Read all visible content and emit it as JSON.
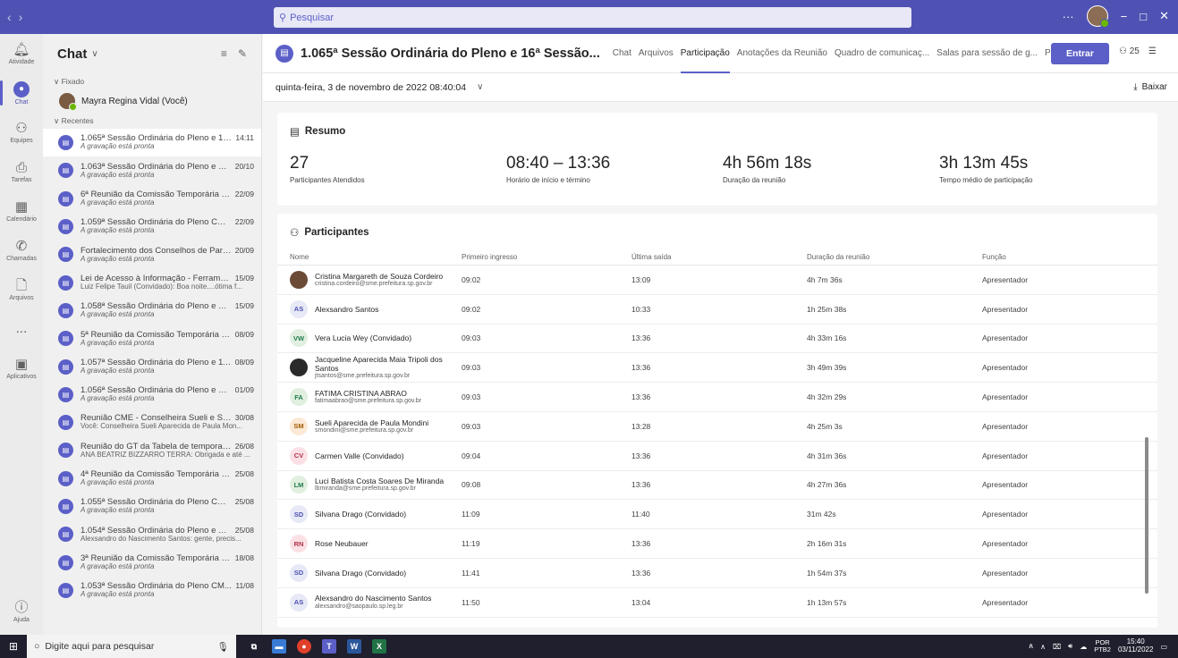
{
  "titlebar": {
    "search_placeholder": "Pesquisar",
    "more": "···",
    "minimize": "−",
    "maximize": "□",
    "close": "✕"
  },
  "appbar": {
    "items": [
      {
        "label": "Atividade",
        "icon": "bell-icon"
      },
      {
        "label": "Chat",
        "icon": "chat-icon"
      },
      {
        "label": "Equipes",
        "icon": "teams-icon"
      },
      {
        "label": "Tarefas",
        "icon": "tasks-icon"
      },
      {
        "label": "Calendário",
        "icon": "calendar-icon"
      },
      {
        "label": "Chamadas",
        "icon": "phone-icon"
      },
      {
        "label": "Arquivos",
        "icon": "files-icon"
      },
      {
        "label": "...",
        "icon": "more-icon"
      },
      {
        "label": "Aplicativos",
        "icon": "apps-icon"
      }
    ],
    "help_label": "Ajuda"
  },
  "chatlist": {
    "title": "Chat",
    "pinned_label": "Fixado",
    "recent_label": "Recentes",
    "pinned": {
      "name": "Mayra Regina Vidal (Você)"
    },
    "items": [
      {
        "title": "1.065ª Sessão Ordinária do Pleno e 16...",
        "date": "14:11",
        "preview": "A gravação está pronta",
        "italic": true
      },
      {
        "title": "1.063ª Sessão Ordinária do Pleno e 14...",
        "date": "20/10",
        "preview": "A gravação está pronta",
        "italic": true
      },
      {
        "title": "6ª Reunião da Comissão Temporária d...",
        "date": "22/09",
        "preview": "A gravação está pronta",
        "italic": true
      },
      {
        "title": "1.059ª Sessão Ordinária do Pleno CM...",
        "date": "22/09",
        "preview": "A gravação está pronta",
        "italic": true
      },
      {
        "title": "Fortalecimento dos Conselhos de Part...",
        "date": "20/09",
        "preview": "A gravação está pronta",
        "italic": true
      },
      {
        "title": "Lei de Acesso à Informação - Ferrame...",
        "date": "15/09",
        "preview": "Luiz Felipe Tauil (Convidado): Boa noite....ótima f...",
        "italic": false
      },
      {
        "title": "1.058ª Sessão Ordinária do Pleno e 12...",
        "date": "15/09",
        "preview": "A gravação está pronta",
        "italic": true
      },
      {
        "title": "5ª Reunião da Comissão Temporária d...",
        "date": "08/09",
        "preview": "A gravação está pronta",
        "italic": true
      },
      {
        "title": "1.057ª Sessão Ordinária do Pleno e 11...",
        "date": "08/09",
        "preview": "A gravação está pronta",
        "italic": true
      },
      {
        "title": "1.056ª Sessão Ordinária do Pleno e 10...",
        "date": "01/09",
        "preview": "A gravação está pronta",
        "italic": true
      },
      {
        "title": "Reunião CME - Conselheira Sueli e Se...",
        "date": "30/08",
        "preview": "Você: Conselheira Sueli Aparecida de Paula Mon...",
        "italic": false
      },
      {
        "title": "Reunião do GT da Tabela de temporali...",
        "date": "26/08",
        "preview": "ANA BEATRIZ BIZZARRO TERRA: Obrigada e até ...",
        "italic": false
      },
      {
        "title": "4ª Reunião da Comissão Temporária d...",
        "date": "25/08",
        "preview": "A gravação está pronta",
        "italic": true
      },
      {
        "title": "1.055ª Sessão Ordinária do Pleno CM...",
        "date": "25/08",
        "preview": "A gravação está pronta",
        "italic": true
      },
      {
        "title": "1.054ª Sessão Ordinária do Pleno e 9ª...",
        "date": "25/08",
        "preview": "Alexsandro do Nascimento Santos: gente, precis...",
        "italic": false
      },
      {
        "title": "3ª Reunião da Comissão Temporária d...",
        "date": "18/08",
        "preview": "A gravação está pronta",
        "italic": true
      },
      {
        "title": "1.053ª Sessão Ordinária do Pleno CM...",
        "date": "11/08",
        "preview": "A gravação está pronta",
        "italic": true
      }
    ]
  },
  "header": {
    "title": "1.065ª Sessão Ordinária do Pleno e 16ª Sessão...",
    "tabs": [
      "Chat",
      "Arquivos",
      "Participação",
      "Anotações da Reunião",
      "Quadro de comunicaç...",
      "Salas para sessão de g...",
      "P&R"
    ],
    "active_tab": "Participação",
    "join_label": "Entrar",
    "participants_count": "25"
  },
  "subheader": {
    "date": "quinta-feira, 3 de novembro de 2022 08:40:04",
    "download_label": "Baixar"
  },
  "summary": {
    "title": "Resumo",
    "stats": [
      {
        "value": "27",
        "label": "Participantes Atendidos"
      },
      {
        "value": "08:40 – 13:36",
        "label": "Horário de início e término"
      },
      {
        "value": "4h 56m 18s",
        "label": "Duração da reunião"
      },
      {
        "value": "3h 13m 45s",
        "label": "Tempo médio de participação"
      }
    ]
  },
  "participants": {
    "title": "Participantes",
    "columns": [
      "Nome",
      "Primeiro ingresso",
      "Última saída",
      "Duração da reunião",
      "Função"
    ],
    "rows": [
      {
        "name": "Cristina Margareth de Souza Cordeiro",
        "email": "cristina.cordeiro@sme.prefeitura.sp.gov.br",
        "initials": "",
        "color": "photo",
        "first": "09:02",
        "last": "13:09",
        "duration": "4h 7m 36s",
        "role": "Apresentador"
      },
      {
        "name": "Alexsandro Santos",
        "email": "",
        "initials": "AS",
        "color": "#e7e9f6",
        "fg": "#4f52b2",
        "first": "09:02",
        "last": "10:33",
        "duration": "1h 25m 38s",
        "role": "Apresentador"
      },
      {
        "name": "Vera Lucia Wey (Convidado)",
        "email": "",
        "initials": "VW",
        "color": "#e0efe0",
        "fg": "#237b4b",
        "first": "09:03",
        "last": "13:36",
        "duration": "4h 33m 16s",
        "role": "Apresentador"
      },
      {
        "name": "Jacqueline Aparecida Maia Tripoli dos Santos",
        "email": "jtsantos@sme.prefeitura.sp.gov.br",
        "initials": "",
        "color": "photo2",
        "first": "09:03",
        "last": "13:36",
        "duration": "3h 49m 39s",
        "role": "Apresentador"
      },
      {
        "name": "FATIMA CRISTINA ABRAO",
        "email": "fatimaabrao@sme.prefeitura.sp.gov.br",
        "initials": "FA",
        "color": "#e0efe0",
        "fg": "#237b4b",
        "first": "09:03",
        "last": "13:36",
        "duration": "4h 32m 29s",
        "role": "Apresentador"
      },
      {
        "name": "Sueli Aparecida de Paula Mondini",
        "email": "smondini@sme.prefeitura.sp.gov.br",
        "initials": "SM",
        "color": "#fbe9d5",
        "fg": "#a05a00",
        "first": "09:03",
        "last": "13:28",
        "duration": "4h 25m 3s",
        "role": "Apresentador"
      },
      {
        "name": "Carmen Valle (Convidado)",
        "email": "",
        "initials": "CV",
        "color": "#fbe1e6",
        "fg": "#b0304a",
        "first": "09:04",
        "last": "13:36",
        "duration": "4h 31m 36s",
        "role": "Apresentador"
      },
      {
        "name": "Luci Batista Costa Soares De Miranda",
        "email": "lbmiranda@sme.prefeitura.sp.gov.br",
        "initials": "LM",
        "color": "#e0efe0",
        "fg": "#237b4b",
        "first": "09:08",
        "last": "13:36",
        "duration": "4h 27m 36s",
        "role": "Apresentador"
      },
      {
        "name": "Silvana Drago (Convidado)",
        "email": "",
        "initials": "SD",
        "color": "#e7e9f6",
        "fg": "#4f52b2",
        "first": "11:09",
        "last": "11:40",
        "duration": "31m 42s",
        "role": "Apresentador"
      },
      {
        "name": "Rose Neubauer",
        "email": "",
        "initials": "RN",
        "color": "#fbe1e6",
        "fg": "#b0304a",
        "first": "11:19",
        "last": "13:36",
        "duration": "2h 16m 31s",
        "role": "Apresentador"
      },
      {
        "name": "Silvana Drago (Convidado)",
        "email": "",
        "initials": "SD",
        "color": "#e7e9f6",
        "fg": "#4f52b2",
        "first": "11:41",
        "last": "13:36",
        "duration": "1h 54m 37s",
        "role": "Apresentador"
      },
      {
        "name": "Alexsandro do Nascimento Santos",
        "email": "alexsandro@saopaulo.sp.leg.br",
        "initials": "AS",
        "color": "#e7e9f6",
        "fg": "#4f52b2",
        "first": "11:50",
        "last": "13:04",
        "duration": "1h 13m 57s",
        "role": "Apresentador"
      }
    ]
  },
  "taskbar": {
    "search_placeholder": "Digite aqui para pesquisar",
    "lang1": "POR",
    "lang2": "PTB2",
    "time": "15:40",
    "date": "03/11/2022"
  }
}
